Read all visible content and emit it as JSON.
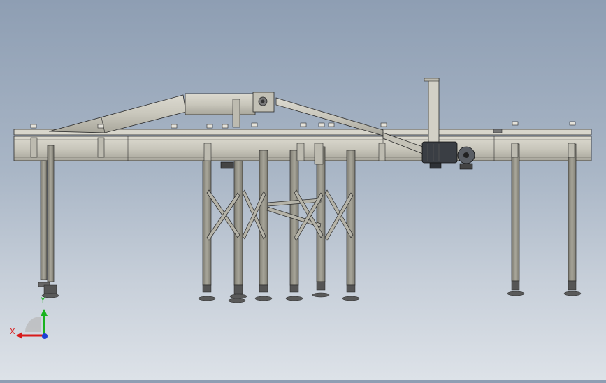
{
  "view": {
    "type": "cad-3d-viewport",
    "model": "conveyor-assembly",
    "background_top": "#8e9eb3",
    "background_bottom": "#dde2e8",
    "steel_color": "#c9c7bc",
    "steel_shadow": "#8d8a80",
    "leg_color": "#9c9a8f",
    "edge_color": "#2a2a2a",
    "motor_color": "#3a3e44"
  },
  "triad": {
    "x_label": "X",
    "y_label": "Y",
    "x_color": "#d81b1b",
    "y_color": "#19b31f",
    "z_color": "#1c3fd6"
  }
}
